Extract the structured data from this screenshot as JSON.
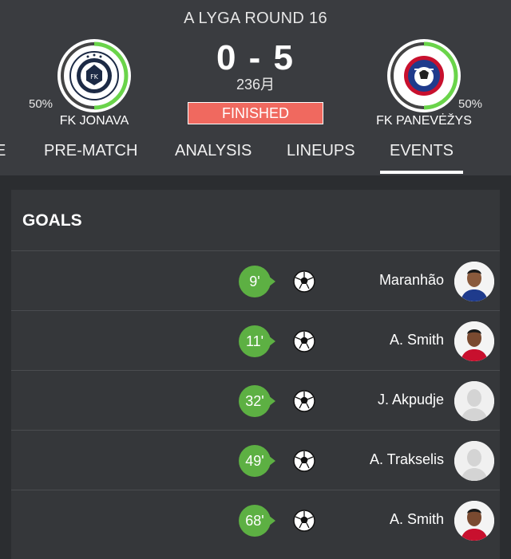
{
  "match": {
    "round": "A LYGA ROUND 16",
    "score": "0 - 5",
    "time": "236月",
    "status": "FINISHED",
    "home": {
      "name": "FK JONAVA",
      "possession": "50%",
      "possession_value": 0.5,
      "logo": "fk-jonava-crest"
    },
    "away": {
      "name": "FK PANEVĖŽYS",
      "possession": "50%",
      "possession_value": 0.5,
      "logo": "fk-panevezys-crest"
    }
  },
  "tabs": [
    {
      "label": "E"
    },
    {
      "label": "PRE-MATCH"
    },
    {
      "label": "ANALYSIS"
    },
    {
      "label": "LINEUPS"
    },
    {
      "label": "EVENTS",
      "active": true
    }
  ],
  "events": {
    "section_title": "GOALS",
    "goals": [
      {
        "minute": "9'",
        "player": "Maranhão",
        "photo": "player-dark-kit"
      },
      {
        "minute": "11'",
        "player": "A. Smith",
        "photo": "player-red-kit"
      },
      {
        "minute": "32'",
        "player": "J. Akpudje",
        "photo": "player-placeholder"
      },
      {
        "minute": "49'",
        "player": "A. Trakselis",
        "photo": "player-placeholder"
      },
      {
        "minute": "68'",
        "player": "A. Smith",
        "photo": "player-red-kit"
      }
    ]
  },
  "colors": {
    "header_bg": "#3a3c40",
    "page_bg": "#2b2d30",
    "panel_bg": "#35373a",
    "status_badge": "#f0695f",
    "minute_badge": "#5db043",
    "possession_ring": "#6ad44a"
  }
}
